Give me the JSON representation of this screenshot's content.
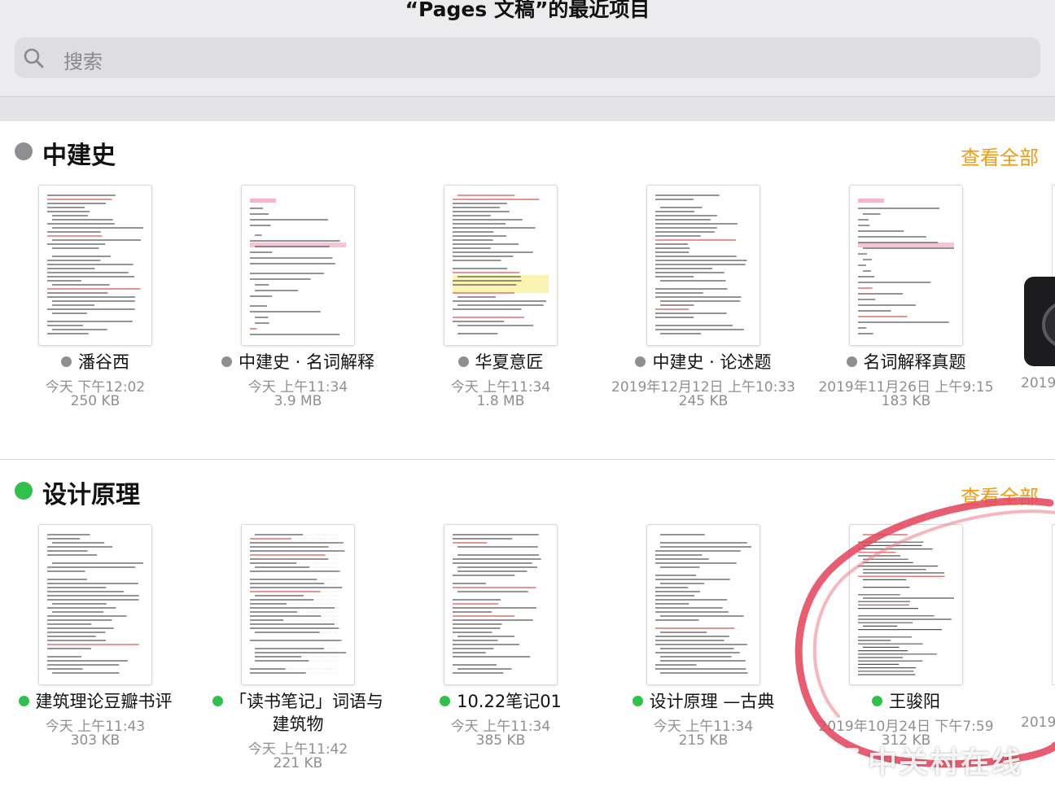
{
  "window": {
    "title": "“Pages 文稿”的最近项目"
  },
  "search": {
    "placeholder": "搜索",
    "icon": "search-icon"
  },
  "colors": {
    "accent": "#f29a11",
    "tag_gray": "#8e8e93",
    "tag_green": "#2fc14b",
    "annotation_red": "#e4485e"
  },
  "sections": [
    {
      "title": "中建史",
      "tag_color": "gray",
      "see_all": "查看全部",
      "docs": [
        {
          "name": "潘谷西",
          "date": "今天 下午12:02",
          "size": "250 KB"
        },
        {
          "name": "中建史 · 名词解释",
          "date": "今天 上午11:34",
          "size": "3.9 MB"
        },
        {
          "name": "华夏意匠",
          "date": "今天 上午11:34",
          "size": "1.8 MB"
        },
        {
          "name": "中建史 · 论述题",
          "date": "2019年12月12日 上午10:33",
          "size": "245 KB"
        },
        {
          "name": "名词解释真题",
          "date": "2019年11月26日 上午9:15",
          "size": "183 KB"
        }
      ],
      "peek_date": "2019"
    },
    {
      "title": "设计原理",
      "tag_color": "green",
      "see_all": "查看全部",
      "docs": [
        {
          "name": "建筑理论豆瓣书评",
          "name_line2": "",
          "date": "今天 上午11:43",
          "size": "303 KB"
        },
        {
          "name": "「读书笔记」词语与",
          "name_line2": "建筑物",
          "date": "今天 上午11:42",
          "size": "221 KB"
        },
        {
          "name": "10.22笔记01",
          "name_line2": "",
          "date": "今天 上午11:34",
          "size": "385 KB"
        },
        {
          "name": "设计原理 —古典",
          "name_line2": "",
          "date": "今天 上午11:34",
          "size": "215 KB"
        },
        {
          "name": "王骏阳",
          "name_line2": "",
          "date": "2019年10月24日 下午7:59",
          "size": "312 KB"
        }
      ],
      "peek_date": "2019"
    }
  ],
  "watermark": {
    "text": "中关村在线"
  }
}
